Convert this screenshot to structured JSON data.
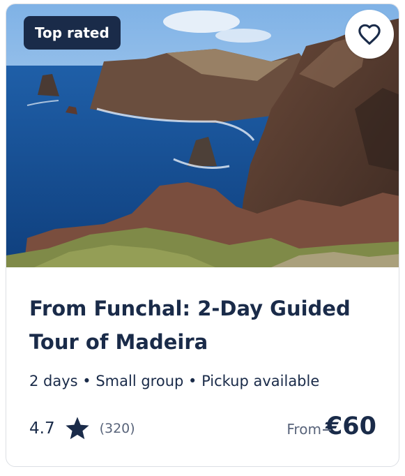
{
  "card": {
    "badge_label": "Top rated",
    "image_alt": "Rocky coastal cliffs above the ocean",
    "title": "From Funchal: 2-Day Guided Tour of Madeira",
    "details": "2 days • Small group • Pickup available",
    "rating_value": "4.7",
    "review_count": "(320)",
    "price_prefix": "From",
    "price_amount": "€60"
  },
  "icons": {
    "favorite": "heart-outline-icon",
    "rating": "star-icon"
  },
  "colors": {
    "primary_text": "#1a2b49",
    "badge_bg": "#1a2b49",
    "muted_text": "#59647a",
    "card_border": "#dcdfe4"
  }
}
